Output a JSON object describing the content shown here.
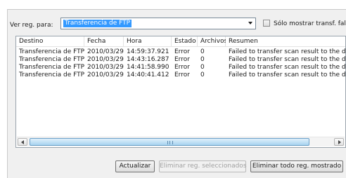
{
  "filter": {
    "label": "Ver reg. para:",
    "selected": "Transferencia de FTP",
    "checkbox_label": "Sólo mostrar transf. fallidas",
    "checkbox_checked": false
  },
  "log_table": {
    "columns": [
      "Destino",
      "Fecha",
      "Hora",
      "Estado",
      "Archivos",
      "Resumen"
    ],
    "rows": [
      [
        "Transferencia de FTP",
        "2010/03/29",
        "14:59:37.921",
        "Error",
        "0",
        "Failed to transfer scan result to the de"
      ],
      [
        "Transferencia de FTP",
        "2010/03/29",
        "14:43:16.287",
        "Error",
        "0",
        "Failed to transfer scan result to the de"
      ],
      [
        "Transferencia de FTP",
        "2010/03/29",
        "14:41:58.990",
        "Error",
        "0",
        "Failed to transfer scan result to the de"
      ],
      [
        "Transferencia de FTP",
        "2010/03/29",
        "14:40:41.412",
        "Error",
        "0",
        "Failed to transfer scan result to the de"
      ]
    ],
    "scrollbar_grip": "III"
  },
  "buttons": {
    "refresh": "Actualizar",
    "delete_selected": "Eliminar reg. seleccionados",
    "delete_all_shown": "Eliminar todo reg. mostrado"
  }
}
